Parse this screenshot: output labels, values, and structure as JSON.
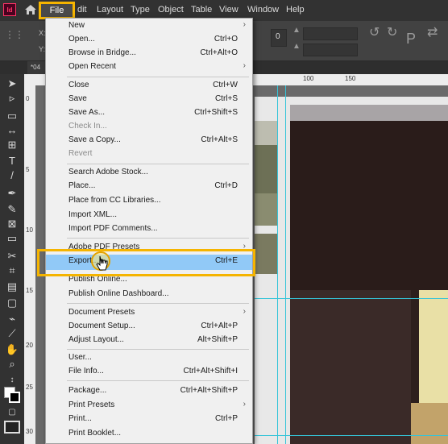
{
  "app": {
    "logo": "Id"
  },
  "menubar": {
    "items": [
      "File",
      "Edit",
      "Layout",
      "Type",
      "Object",
      "Table",
      "View",
      "Window",
      "Help"
    ],
    "visible_labels": [
      "File",
      "dit",
      "Layout",
      "Type",
      "Object",
      "Table",
      "View",
      "Window",
      "Help"
    ]
  },
  "controlbar": {
    "x_label": "X:",
    "y_label": "Y:",
    "stroke_value": "0"
  },
  "document": {
    "tab_label": "*04"
  },
  "ruler": {
    "h_ticks": [
      "100",
      "150"
    ],
    "v_ticks": [
      "0",
      "5",
      "10",
      "15",
      "20",
      "25",
      "30"
    ]
  },
  "file_menu": {
    "items": [
      {
        "label": "New",
        "shortcut": "",
        "submenu": true
      },
      {
        "label": "Open...",
        "shortcut": "Ctrl+O"
      },
      {
        "label": "Browse in Bridge...",
        "shortcut": "Ctrl+Alt+O"
      },
      {
        "label": "Open Recent",
        "shortcut": "",
        "submenu": true
      },
      {
        "label": "Close",
        "shortcut": "Ctrl+W"
      },
      {
        "label": "Save",
        "shortcut": "Ctrl+S"
      },
      {
        "label": "Save As...",
        "shortcut": "Ctrl+Shift+S"
      },
      {
        "label": "Check In...",
        "shortcut": "",
        "disabled": true
      },
      {
        "label": "Save a Copy...",
        "shortcut": "Ctrl+Alt+S"
      },
      {
        "label": "Revert",
        "shortcut": "",
        "disabled": true
      },
      {
        "label": "Search Adobe Stock...",
        "shortcut": ""
      },
      {
        "label": "Place...",
        "shortcut": "Ctrl+D"
      },
      {
        "label": "Place from CC Libraries...",
        "shortcut": ""
      },
      {
        "label": "Import XML...",
        "shortcut": ""
      },
      {
        "label": "Import PDF Comments...",
        "shortcut": ""
      },
      {
        "label": "Adobe PDF Presets",
        "shortcut": "",
        "submenu": true
      },
      {
        "label": "Export...",
        "shortcut": "Ctrl+E",
        "selected": true
      },
      {
        "label": "Publish Online...",
        "shortcut": ""
      },
      {
        "label": "Publish Online Dashboard...",
        "shortcut": ""
      },
      {
        "label": "Document Presets",
        "shortcut": "",
        "submenu": true
      },
      {
        "label": "Document Setup...",
        "shortcut": "Ctrl+Alt+P"
      },
      {
        "label": "Adjust Layout...",
        "shortcut": "Alt+Shift+P"
      },
      {
        "label": "User...",
        "shortcut": ""
      },
      {
        "label": "File Info...",
        "shortcut": "Ctrl+Alt+Shift+I"
      },
      {
        "label": "Package...",
        "shortcut": "Ctrl+Alt+Shift+P"
      },
      {
        "label": "Print Presets",
        "shortcut": "",
        "submenu": true
      },
      {
        "label": "Print...",
        "shortcut": "Ctrl+P"
      },
      {
        "label": "Print Booklet...",
        "shortcut": ""
      }
    ]
  },
  "colors": {
    "highlight": "#f5b400",
    "selection": "#91c9f7",
    "guide": "#35c4d8",
    "app_accent": "#ff3366"
  }
}
